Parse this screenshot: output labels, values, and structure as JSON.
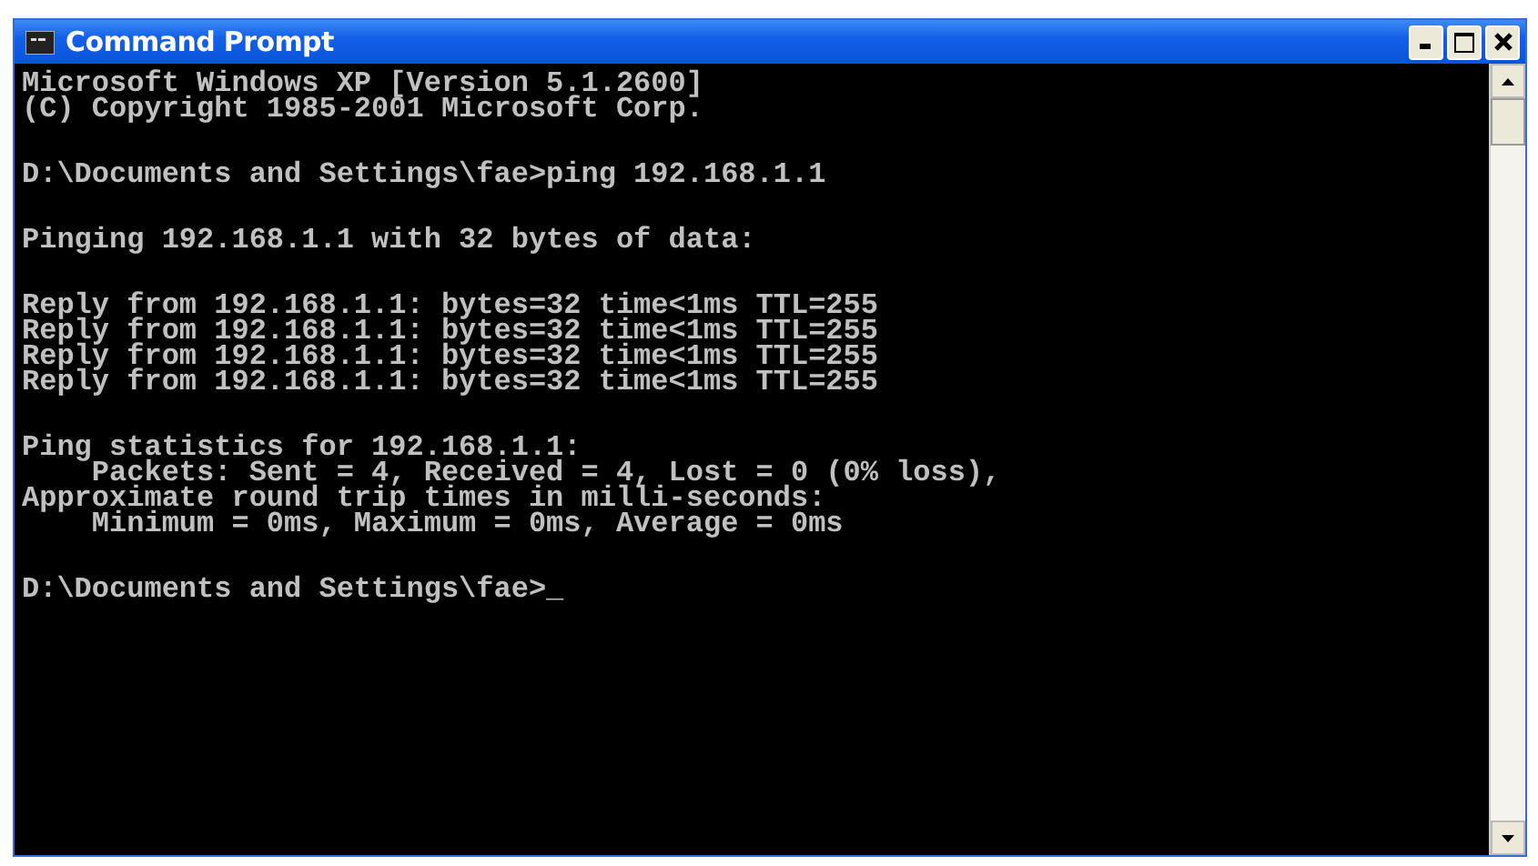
{
  "window": {
    "title": "Command Prompt"
  },
  "console": {
    "blocks": [
      [
        "Microsoft Windows XP [Version 5.1.2600]",
        "(C) Copyright 1985-2001 Microsoft Corp."
      ],
      [
        "D:\\Documents and Settings\\fae>ping 192.168.1.1"
      ],
      [
        "Pinging 192.168.1.1 with 32 bytes of data:"
      ],
      [
        "Reply from 192.168.1.1: bytes=32 time<1ms TTL=255",
        "Reply from 192.168.1.1: bytes=32 time<1ms TTL=255",
        "Reply from 192.168.1.1: bytes=32 time<1ms TTL=255",
        "Reply from 192.168.1.1: bytes=32 time<1ms TTL=255"
      ],
      [
        "Ping statistics for 192.168.1.1:",
        "    Packets: Sent = 4, Received = 4, Lost = 0 (0% loss),",
        "Approximate round trip times in milli-seconds:",
        "    Minimum = 0ms, Maximum = 0ms, Average = 0ms"
      ],
      [
        "D:\\Documents and Settings\\fae>_"
      ]
    ]
  }
}
